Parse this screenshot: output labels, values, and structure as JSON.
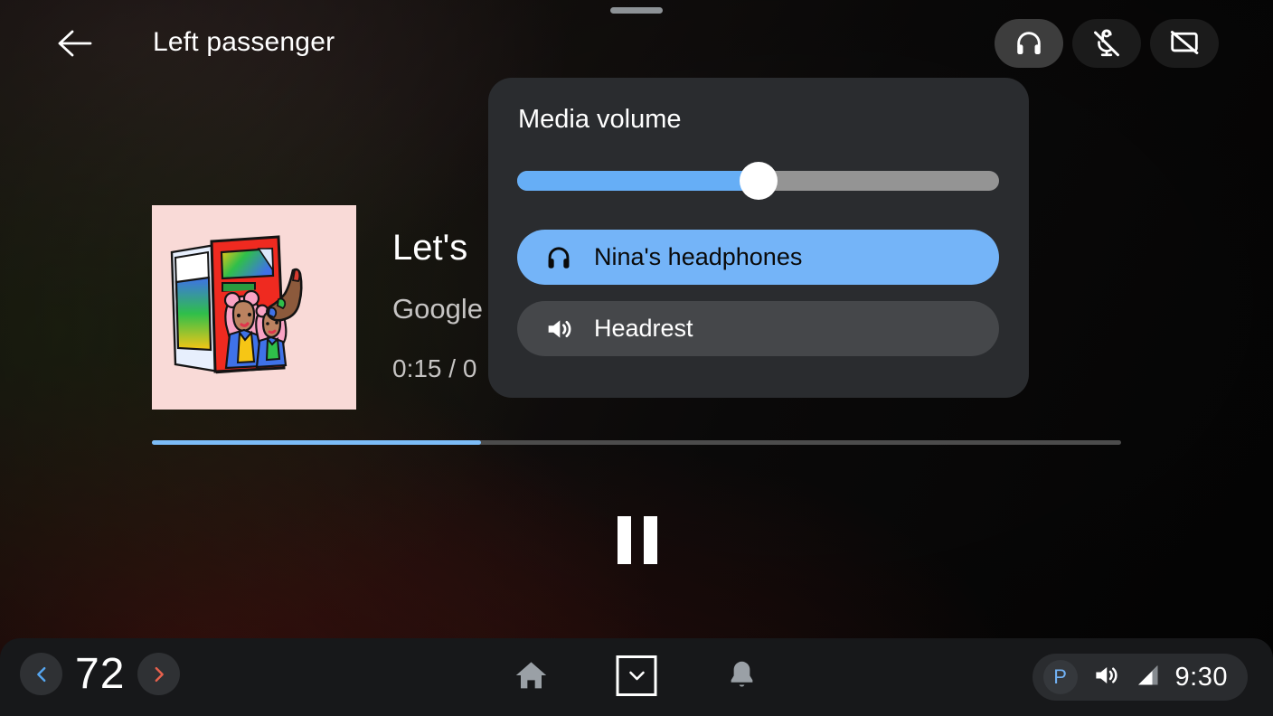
{
  "header": {
    "title": "Left passenger",
    "back_icon": "arrow-left-icon",
    "drag_handle": "drag-handle",
    "buttons": [
      {
        "name": "headphones-toggle",
        "icon": "headphones-icon",
        "active": true
      },
      {
        "name": "mic-off-toggle",
        "icon": "mic-off-icon",
        "active": false
      },
      {
        "name": "screen-off-toggle",
        "icon": "screen-off-icon",
        "active": false
      }
    ]
  },
  "media": {
    "album_art_alt": "album-art",
    "title": "Let's",
    "artist": "Google",
    "time": "0:15 / 0",
    "progress_percent": 34,
    "transport": {
      "state": "playing",
      "button_icon": "pause-icon"
    }
  },
  "volume_panel": {
    "title": "Media volume",
    "slider": {
      "name": "media-volume-slider",
      "value_percent": 50
    },
    "devices": [
      {
        "label": "Nina's headphones",
        "icon": "headphones-icon",
        "selected": true
      },
      {
        "label": "Headrest",
        "icon": "speaker-icon",
        "selected": false
      }
    ]
  },
  "system_bar": {
    "temperature": {
      "value": "72",
      "decrease_icon": "chevron-left-icon",
      "increase_icon": "chevron-right-icon"
    },
    "nav": [
      {
        "name": "home-button",
        "icon": "home-icon"
      },
      {
        "name": "app-drawer-button",
        "icon": "chevron-down-icon"
      },
      {
        "name": "notifications-button",
        "icon": "bell-icon"
      }
    ],
    "status": {
      "gear": "P",
      "volume_icon": "speaker-icon",
      "signal_icon": "signal-bars-icon",
      "time": "9:30"
    }
  },
  "colors": {
    "accent_blue": "#74b4f8",
    "slider_fill": "#66aef6",
    "progress_fill": "#7cbcf7",
    "panel_bg": "#2a2c2f",
    "sysbar_bg": "#17181a",
    "cool_chevron": "#56a6f0",
    "warm_chevron": "#e8614d",
    "park_letter": "#72b2f5"
  }
}
